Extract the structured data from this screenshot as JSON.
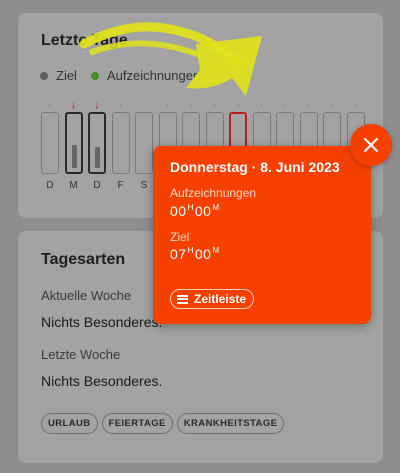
{
  "recent_days": {
    "title": "Letzte Tage",
    "legend": {
      "goal": "Ziel",
      "recordings": "Aufzeichnungen"
    },
    "days": [
      {
        "label": "D",
        "marker": "·",
        "fill": 0
      },
      {
        "label": "M",
        "marker": "↓",
        "fill": 0.42,
        "active": true
      },
      {
        "label": "D",
        "marker": "↓",
        "fill": 0.38,
        "active": true
      },
      {
        "label": "F",
        "marker": "·",
        "fill": 0
      },
      {
        "label": "S",
        "marker": "·",
        "fill": 0
      },
      {
        "label": "",
        "marker": "·",
        "fill": 0
      },
      {
        "label": "",
        "marker": "·",
        "fill": 0
      },
      {
        "label": "",
        "marker": "·",
        "fill": 0
      },
      {
        "label": "",
        "marker": "·",
        "fill": 0,
        "selected": true
      },
      {
        "label": "",
        "marker": "·",
        "fill": 0
      },
      {
        "label": "",
        "marker": "·",
        "fill": 0
      },
      {
        "label": "",
        "marker": "·",
        "fill": 0
      },
      {
        "label": "",
        "marker": "·",
        "fill": 0
      },
      {
        "label": "",
        "marker": "·",
        "fill": 0
      }
    ]
  },
  "day_types": {
    "title": "Tagesarten",
    "current_week_label": "Aktuelle Woche",
    "current_week_value": "Nichts Besonderes.",
    "last_week_label": "Letzte Woche",
    "last_week_value": "Nichts Besonderes.",
    "chips": [
      "URLAUB",
      "FEIERTAGE",
      "KRANKHEITSTAGE"
    ]
  },
  "popover": {
    "date": "Donnerstag · 8. Juni 2023",
    "recordings_label": "Aufzeichnungen",
    "recordings": {
      "h": "00",
      "m": "00"
    },
    "goal_label": "Ziel",
    "goal": {
      "h": "07",
      "m": "00"
    },
    "h_unit": "H",
    "m_unit": "M",
    "timeline_button": "Zeitleiste"
  },
  "colors": {
    "accent": "#f64000",
    "highlight": "#dfe31a"
  }
}
